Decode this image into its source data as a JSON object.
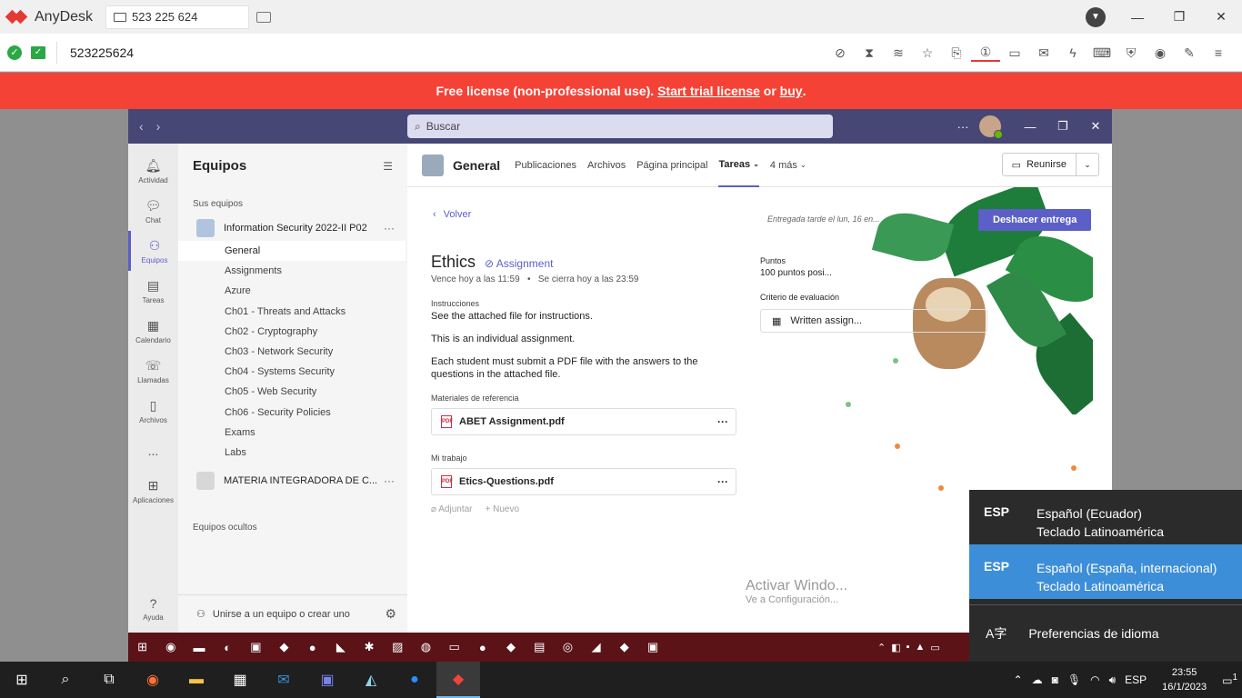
{
  "anydesk": {
    "app_name": "AnyDesk",
    "tab_label": "523 225 624",
    "address": "523225624",
    "banner": {
      "text_prefix": "Free license (non-professional use). ",
      "trial_link": "Start trial license",
      "or": " or ",
      "buy_link": "buy",
      "suffix": "."
    }
  },
  "teams": {
    "search_placeholder": "Buscar",
    "rail": [
      {
        "label": "Actividad",
        "icon": "bell-icon"
      },
      {
        "label": "Chat",
        "icon": "chat-icon"
      },
      {
        "label": "Equipos",
        "icon": "teams-icon"
      },
      {
        "label": "Tareas",
        "icon": "assignments-icon"
      },
      {
        "label": "Calendario",
        "icon": "calendar-icon"
      },
      {
        "label": "Llamadas",
        "icon": "phone-icon"
      },
      {
        "label": "Archivos",
        "icon": "file-icon"
      },
      {
        "label": "...",
        "icon": "more-icon"
      },
      {
        "label": "Aplicaciones",
        "icon": "apps-icon"
      }
    ],
    "help_label": "Ayuda",
    "sidebar": {
      "title": "Equipos",
      "section": "Sus equipos",
      "team1": "Information Security 2022-II P02",
      "channels": [
        "General",
        "Assignments",
        "Azure",
        "Ch01 - Threats and Attacks",
        "Ch02 - Cryptography",
        "Ch03 - Network Security",
        "Ch04 - Systems Security",
        "Ch05 - Web Security",
        "Ch06 - Security Policies",
        "Exams",
        "Labs"
      ],
      "team2": "MATERIA INTEGRADORA DE C...",
      "hidden": "Equipos ocultos",
      "join": "Unirse a un equipo o crear uno"
    },
    "channel": {
      "name": "General",
      "tabs": [
        "Publicaciones",
        "Archivos",
        "Página principal"
      ],
      "active_tab": "Tareas",
      "more_tab": "4 más",
      "meet": "Reunirse"
    },
    "assignment": {
      "back": "Volver",
      "title": "Ethics",
      "tag": "Assignment",
      "due": "Vence hoy a las 11:59",
      "closes": "Se cierra hoy a las 23:59",
      "instructions_label": "Instrucciones",
      "instr1": "See the attached file for instructions.",
      "instr2": "This is an individual assignment.",
      "instr3": "Each student must submit a PDF file with the answers to the questions in the attached file.",
      "ref_label": "Materiales de referencia",
      "ref_file": "ABET Assignment.pdf",
      "work_label": "Mi trabajo",
      "work_file": "Etics-Questions.pdf",
      "attach": "Adjuntar",
      "new": "Nuevo",
      "turned_in": "Entregada tarde el lun, 16 en...",
      "undo": "Deshacer entrega",
      "points_label": "Puntos",
      "points_value": "100 puntos posi...",
      "rubric_label": "Criterio de evaluación",
      "rubric_value": "Written assign..."
    },
    "watermark_title": "Activar Windo...",
    "watermark_sub": "Ve a Configuración..."
  },
  "language_popup": {
    "items": [
      {
        "code": "ESP",
        "lang": "Español (Ecuador)",
        "kbd": "Teclado Latinoamérica"
      },
      {
        "code": "ESP",
        "lang": "Español (España, internacional)",
        "kbd": "Teclado Latinoamérica"
      }
    ],
    "prefs": "Preferencias de idioma"
  },
  "taskbar": {
    "lang": "ESP",
    "time": "23:55",
    "date": "16/1/2023",
    "notif_count": "1"
  }
}
